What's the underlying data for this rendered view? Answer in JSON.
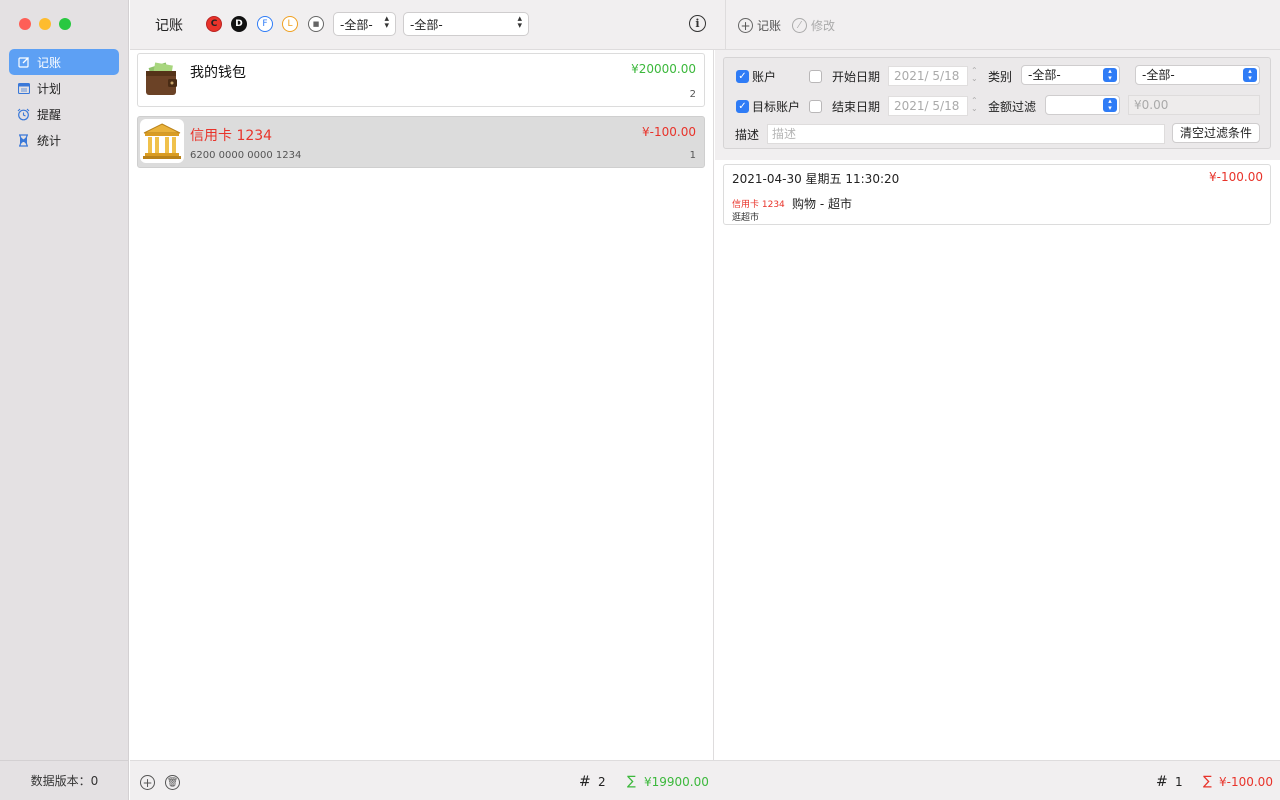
{
  "sidebar": {
    "items": [
      {
        "label": "记账",
        "icon": "edit-icon"
      },
      {
        "label": "计划",
        "icon": "calendar-icon"
      },
      {
        "label": "提醒",
        "icon": "alarm-icon"
      },
      {
        "label": "统计",
        "icon": "hourglass-icon"
      }
    ],
    "footer": "数据版本：0"
  },
  "toolbar": {
    "title": "记账",
    "badges": [
      "C",
      "D",
      "F",
      "L",
      "■"
    ],
    "popup1": "-全部-",
    "popup2": "-全部-",
    "info": "i",
    "add_label": "记账",
    "edit_label": "修改"
  },
  "accounts": [
    {
      "name": "我的钱包",
      "amount": "¥20000.00",
      "count": "2",
      "sub": ""
    },
    {
      "name": "信用卡 1234",
      "amount": "¥-100.00",
      "count": "1",
      "sub": "6200 0000 0000 1234"
    }
  ],
  "left_footer": {
    "count_symbol": "#",
    "count": "2",
    "sum_symbol": "∑",
    "sum": "¥19900.00"
  },
  "filters": {
    "account_label": "账户",
    "target_account_label": "目标账户",
    "start_date_label": "开始日期",
    "end_date_label": "结束日期",
    "start_date": "2021/ 5/18",
    "end_date": "2021/ 5/18",
    "category_label": "类别",
    "category1": "-全部-",
    "category2": "-全部-",
    "amount_filter_label": "金额过滤",
    "amount_value": "¥0.00",
    "desc_label": "描述",
    "desc_placeholder": "描述",
    "clear_label": "清空过滤条件"
  },
  "transactions": [
    {
      "datetime": "2021-04-30 星期五 11:30:20",
      "amount": "¥-100.00",
      "account": "信用卡 1234",
      "category": "购物 - 超市",
      "note": "逛超市"
    }
  ],
  "right_footer": {
    "count_symbol": "#",
    "count": "1",
    "sum_symbol": "∑",
    "sum": "¥-100.00"
  },
  "colors": {
    "accent": "#5da0f4",
    "positive": "#3cb83c",
    "negative": "#e8332a"
  }
}
